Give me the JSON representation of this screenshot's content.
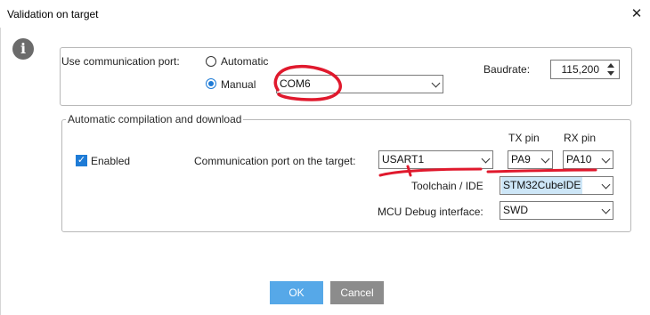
{
  "window": {
    "title": "Validation on target",
    "close_glyph": "✕"
  },
  "icons": {
    "info": "info-icon",
    "info_glyph": "i",
    "check_glyph": "✓"
  },
  "comm": {
    "label": "Use communication port:",
    "automatic_label": "Automatic",
    "manual_label": "Manual",
    "selected_mode": "Manual",
    "port_value": "COM6",
    "baudrate_label": "Baudrate:",
    "baudrate_value": "115,200"
  },
  "auto": {
    "legend": "Automatic compilation and download",
    "enabled_label": "Enabled",
    "enabled_checked": true,
    "tx_header": "TX pin",
    "rx_header": "RX pin",
    "comm_port_label": "Communication port on the target:",
    "comm_port_value": "USART1",
    "tx_value": "PA9",
    "rx_value": "PA10",
    "toolchain_label": "Toolchain / IDE",
    "toolchain_value": "STM32CubeIDE",
    "debug_label": "MCU Debug interface:",
    "debug_value": "SWD"
  },
  "buttons": {
    "ok": "OK",
    "cancel": "Cancel"
  },
  "colors": {
    "accent": "#1e7bd6",
    "ok_button": "#56a8e8",
    "cancel_button": "#8c8c8c",
    "annotation_red": "#e0192d",
    "highlight": "#cde6f7"
  }
}
